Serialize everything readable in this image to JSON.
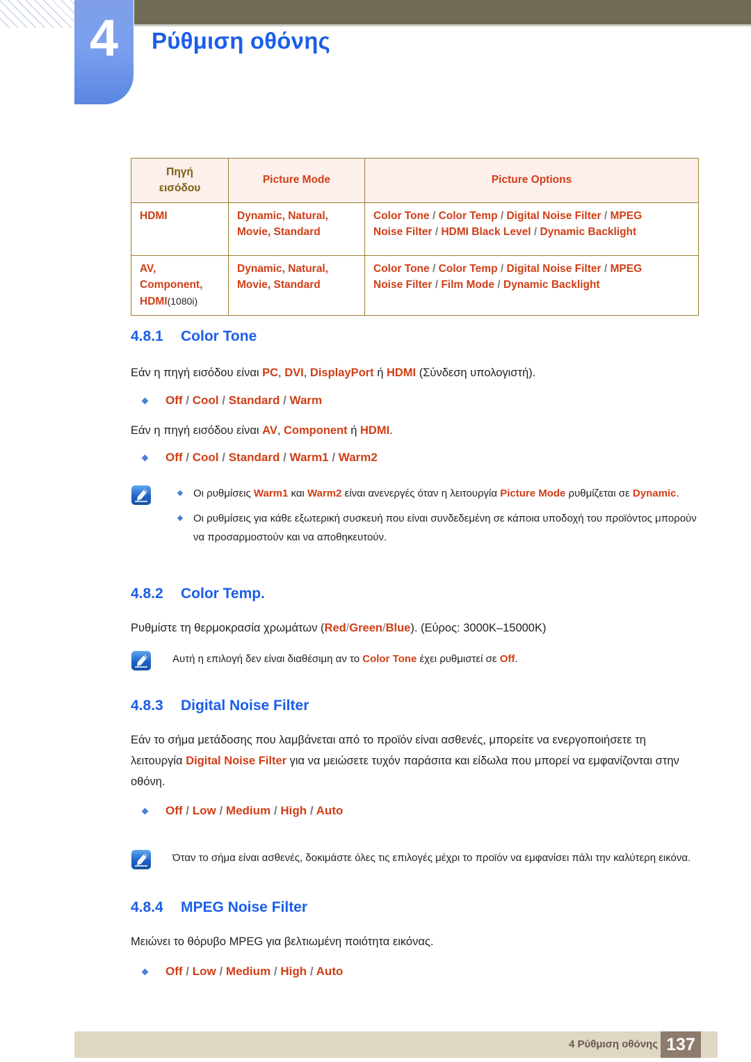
{
  "header": {
    "chapter_number": "4",
    "chapter_title": "Ρύθμιση οθόνης"
  },
  "table": {
    "headers": [
      "Πηγή εισόδου",
      "Picture Mode",
      "Picture Options"
    ],
    "header_line1": "Πηγή",
    "header_line2": "εισόδου",
    "rows": [
      {
        "source_lines": [
          "HDMI"
        ],
        "source_suffix": "",
        "picture_mode_line1": "Dynamic, Natural,",
        "picture_mode_line2": "Movie, Standard",
        "options_line1": "Color Tone / Color Temp / Digital Noise Filter / MPEG",
        "options_line2": "Noise Filter / HDMI Black Level / Dynamic Backlight"
      },
      {
        "source_lines": [
          "AV,",
          "Component,",
          "HDMI"
        ],
        "source_suffix": "(1080i)",
        "picture_mode_line1": "Dynamic, Natural,",
        "picture_mode_line2": "Movie, Standard",
        "options_line1": "Color Tone / Color Temp / Digital Noise Filter / MPEG",
        "options_line2": "Noise Filter / Film Mode / Dynamic Backlight"
      }
    ]
  },
  "sections": {
    "s481": {
      "number": "4.8.1",
      "title": "Color Tone",
      "para1_pre": "Εάν η πηγή εισόδου είναι ",
      "para1_b1": "PC",
      "para1_b2": "DVI",
      "para1_b3": "DisplayPort",
      "para1_mid": " ή ",
      "para1_b4": "HDMI",
      "para1_post": " (Σύνδεση υπολογιστή).",
      "options1": "Off / Cool / Standard / Warm",
      "para2_pre": "Εάν η πηγή εισόδου είναι ",
      "para2_b1": "AV",
      "para2_b2": "Component",
      "para2_mid": " ή ",
      "para2_b3": "HDMI",
      "para2_post": ".",
      "options2": "Off / Cool / Standard / Warm1 / Warm2",
      "note_item1_pre": "Οι ρυθμίσεις ",
      "note_item1_b1": "Warm1",
      "note_item1_and": " και ",
      "note_item1_b2": "Warm2",
      "note_item1_mid": " είναι ανενεργές όταν η λειτουργία ",
      "note_item1_b3": "Picture Mode",
      "note_item1_post": " ρυθμίζεται σε ",
      "note_item1_b4": "Dynamic",
      "note_item1_end": ".",
      "note_item2": "Οι ρυθμίσεις για κάθε εξωτερική συσκευή που είναι συνδεδεμένη σε κάποια υποδοχή του προϊόντος μπορούν να προσαρμοστούν και να αποθηκευτούν."
    },
    "s482": {
      "number": "4.8.2",
      "title": "Color Temp.",
      "para_pre": "Ρυθμίστε τη θερμοκρασία χρωμάτων (",
      "para_b1": "Red",
      "para_b2": "Green",
      "para_b3": "Blue",
      "para_post": "). (Εύρος: 3000K–15000K)",
      "note_pre": "Αυτή η επιλογή δεν είναι διαθέσιμη αν το ",
      "note_b1": "Color Tone",
      "note_mid": " έχει ρυθμιστεί σε ",
      "note_b2": "Off",
      "note_post": "."
    },
    "s483": {
      "number": "4.8.3",
      "title": "Digital Noise Filter",
      "para_pre": "Εάν το σήμα μετάδοσης που λαμβάνεται από το προϊόν είναι ασθενές, μπορείτε να ενεργοποιήσετε τη λειτουργία ",
      "para_b1": "Digital Noise Filter",
      "para_post": " για να μειώσετε τυχόν παράσιτα και είδωλα που μπορεί να εμφανίζονται στην οθόνη.",
      "options": "Off / Low / Medium / High / Auto",
      "note": "Όταν το σήμα είναι ασθενές, δοκιμάστε όλες τις επιλογές μέχρι το προϊόν να εμφανίσει πάλι την καλύτερη εικόνα."
    },
    "s484": {
      "number": "4.8.4",
      "title": "MPEG Noise Filter",
      "para": "Μειώνει το θόρυβο MPEG για βελτιωμένη ποιότητα εικόνας.",
      "options": "Off / Low / Medium / High / Auto"
    }
  },
  "footer": {
    "text": "4 Ρύθμιση οθόνης",
    "page": "137"
  },
  "colors": {
    "accent_blue": "#1b5ee8",
    "orange": "#cf3f17",
    "olive": "#6f6b54",
    "table_header_bg": "#fdefec",
    "table_border": "#9a7d2e",
    "footer_bg": "#ddd7c3",
    "page_badge_bg": "#8d7b6e"
  },
  "icons": {
    "note": "note-pen-icon"
  }
}
